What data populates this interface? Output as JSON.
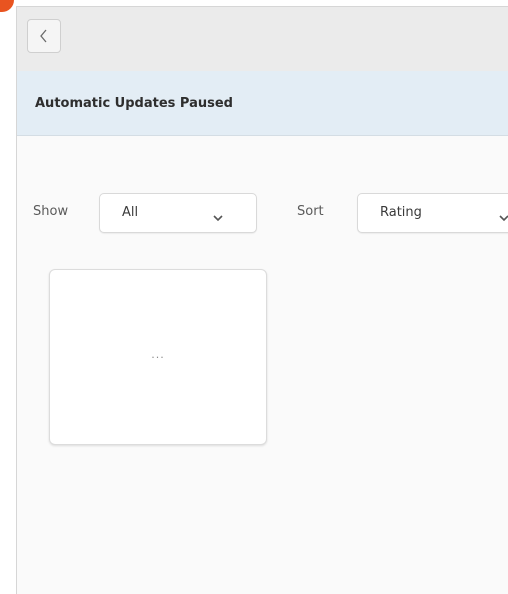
{
  "theme": {
    "accent": "#e95420",
    "banner_bg": "#e3edf5",
    "headerbar_bg": "#ebebeb"
  },
  "headerbar": {
    "back_icon": "chevron-left-icon"
  },
  "banner": {
    "text": "Automatic Updates Paused"
  },
  "filters": {
    "show_label": "Show",
    "show_value": "All",
    "sort_label": "Sort",
    "sort_value": "Rating",
    "dropdown_icon": "chevron-down-icon"
  },
  "cards": [
    {
      "content": "..."
    }
  ]
}
